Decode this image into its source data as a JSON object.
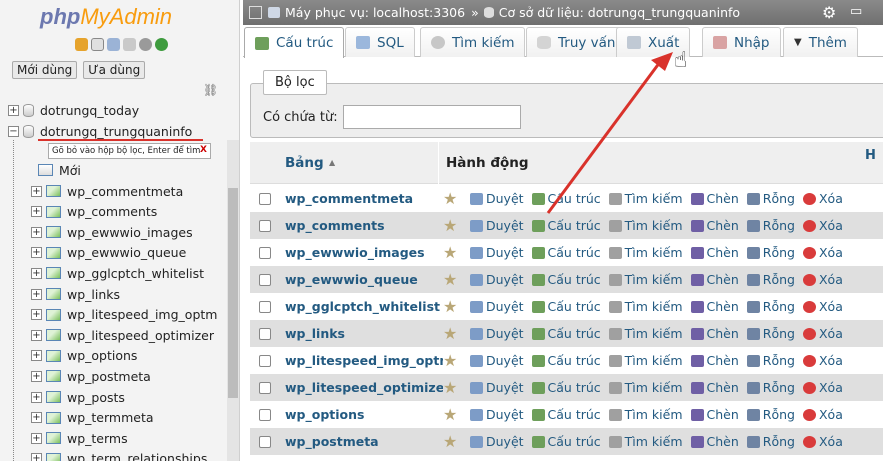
{
  "nav": {
    "logo_php": "php",
    "logo_admin": "MyAdmin",
    "tab_recent": "Mới dùng",
    "tab_favorite": "Ưa dùng",
    "databases": [
      "dotrungq_today",
      "dotrungq_trungquaninfo"
    ],
    "tooltip": "Gõ bỏ vào hộp bộ lọc, Enter để tìm",
    "tooltip_close": "X",
    "new_label": "Mới",
    "tables": [
      "wp_commentmeta",
      "wp_comments",
      "wp_ewwwio_images",
      "wp_ewwwio_queue",
      "wp_gglcptch_whitelist",
      "wp_links",
      "wp_litespeed_img_optm",
      "wp_litespeed_optimizer",
      "wp_options",
      "wp_postmeta",
      "wp_posts",
      "wp_termmeta",
      "wp_terms",
      "wp_term_relationships"
    ]
  },
  "topbar": {
    "server_label": "Máy phục vụ: localhost:3306",
    "separator": "»",
    "db_label": "Cơ sở dữ liệu: dotrungq_trungquaninfo"
  },
  "tabs": [
    "Cấu trúc",
    "SQL",
    "Tìm kiếm",
    "Truy vấn",
    "Xuất",
    "Nhập",
    "Thêm"
  ],
  "filter": {
    "legend": "Bộ lọc",
    "label": "Có chứa từ:",
    "value": ""
  },
  "table": {
    "col_table": "Bảng",
    "col_action": "Hành động",
    "col_extra": "H",
    "actions": [
      "Duyệt",
      "Cấu trúc",
      "Tìm kiếm",
      "Chèn",
      "Rỗng",
      "Xóa"
    ],
    "rows": [
      "wp_commentmeta",
      "wp_comments",
      "wp_ewwwio_images",
      "wp_ewwwio_queue",
      "wp_gglcptch_whitelist",
      "wp_links",
      "wp_litespeed_img_optm",
      "wp_litespeed_optimizer",
      "wp_options",
      "wp_postmeta"
    ]
  },
  "colors": {
    "link": "#235a81",
    "arrow": "#d9322b",
    "logo_php": "#6c78af",
    "logo_admin": "#f89c0e"
  }
}
